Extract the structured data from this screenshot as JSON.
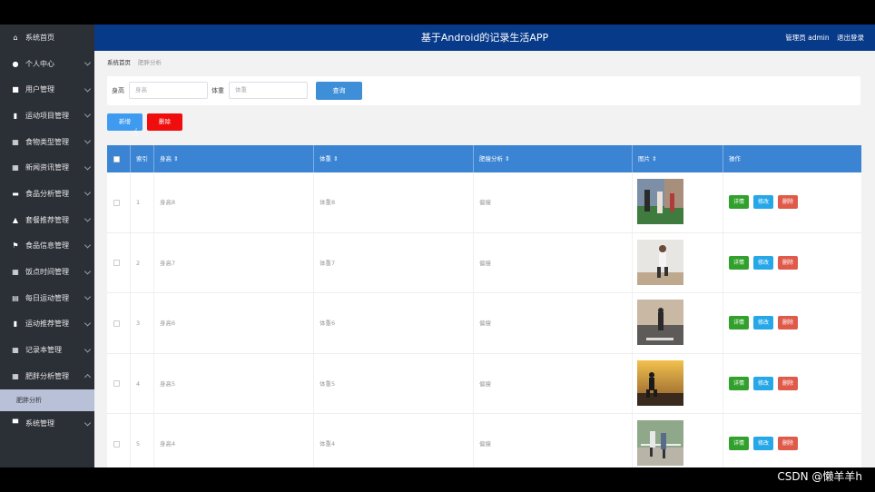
{
  "header": {
    "title": "基于Android的记录生活APP",
    "admin_text": "管理员 admin",
    "logout": "退出登录"
  },
  "sidebar": {
    "items": [
      {
        "label": "系统首页",
        "icon": "home-icon"
      },
      {
        "label": "个人中心",
        "icon": "user-icon"
      },
      {
        "label": "用户管理",
        "icon": "briefcase-icon"
      },
      {
        "label": "运动项目管理",
        "icon": "clipboard-icon"
      },
      {
        "label": "食物类型管理",
        "icon": "grid-icon"
      },
      {
        "label": "新闻资讯管理",
        "icon": "grid-icon"
      },
      {
        "label": "食品分析管理",
        "icon": "book-icon"
      },
      {
        "label": "套餐推荐管理",
        "icon": "thumbs-up-icon"
      },
      {
        "label": "食品信息管理",
        "icon": "flag-icon"
      },
      {
        "label": "饭点时间管理",
        "icon": "grid-icon"
      },
      {
        "label": "每日运动管理",
        "icon": "table-icon"
      },
      {
        "label": "运动推荐管理",
        "icon": "clipboard-icon"
      },
      {
        "label": "记录本管理",
        "icon": "grid-icon"
      },
      {
        "label": "肥胖分析管理",
        "icon": "grid-icon"
      },
      {
        "label": "系统管理",
        "icon": "monitor-icon"
      }
    ],
    "submenu": {
      "label": "肥胖分析"
    }
  },
  "breadcrumb": {
    "home": "系统首页",
    "current": "肥胖分析"
  },
  "search": {
    "height_label": "身高",
    "height_placeholder": "身高",
    "weight_label": "体重",
    "weight_placeholder": "体重",
    "query_button": "查询"
  },
  "actions": {
    "add": "新增",
    "delete": "删除"
  },
  "table": {
    "columns": [
      "索引",
      "身高 ⇕",
      "体重 ⇕",
      "肥瘦分析 ⇕",
      "图片 ⇕",
      "操作"
    ],
    "rows": [
      {
        "index": "1",
        "height": "身高8",
        "weight": "体重8",
        "analysis": "偏瘦"
      },
      {
        "index": "2",
        "height": "身高7",
        "weight": "体重7",
        "analysis": "偏瘦"
      },
      {
        "index": "3",
        "height": "身高6",
        "weight": "体重6",
        "analysis": "偏瘦"
      },
      {
        "index": "4",
        "height": "身高5",
        "weight": "体重5",
        "analysis": "偏瘦"
      },
      {
        "index": "5",
        "height": "身高4",
        "weight": "体重4",
        "analysis": "偏瘦"
      }
    ],
    "ops": {
      "detail": "详情",
      "edit": "修改",
      "remove": "删除"
    }
  },
  "watermark": "CSDN @懒羊羊h",
  "colors": {
    "header": "#083a8a",
    "sidebar": "#2b2f36",
    "table_header": "#3b84d4",
    "detail": "#32a02c",
    "edit": "#26a8e8",
    "remove": "#e05a4a"
  }
}
